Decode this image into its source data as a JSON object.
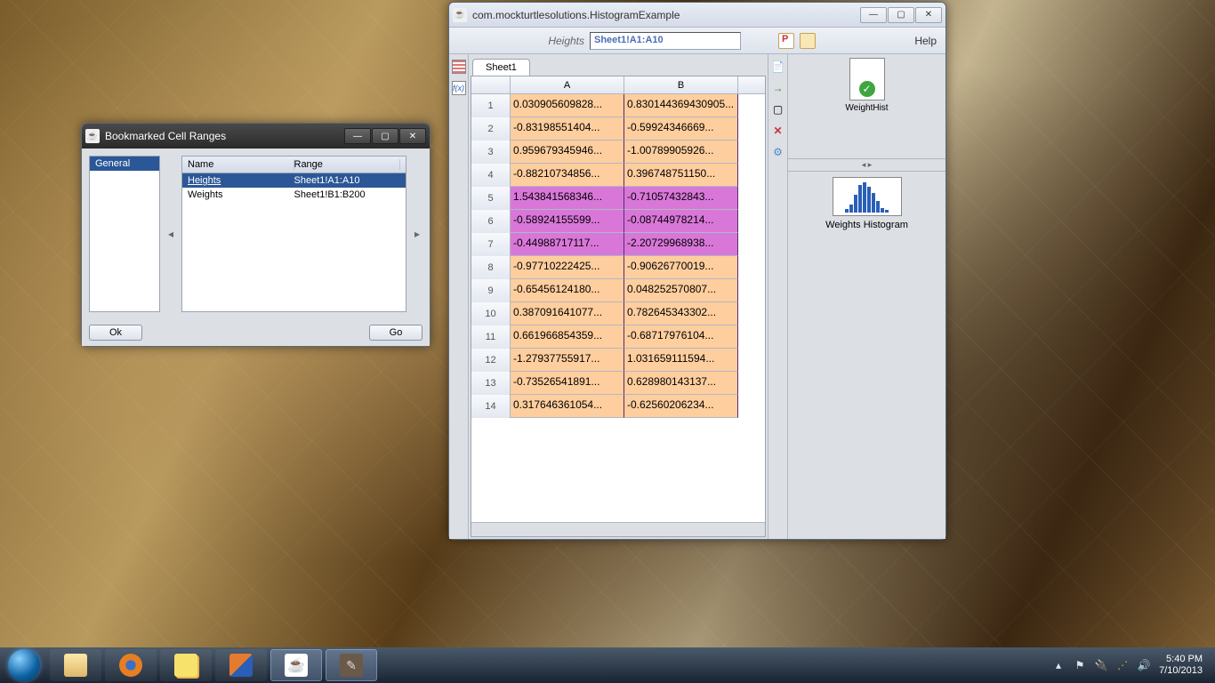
{
  "bookmarks_window": {
    "title": "Bookmarked Cell Ranges",
    "category": "General",
    "columns": {
      "name": "Name",
      "range": "Range"
    },
    "rows": [
      {
        "name": "Heights",
        "range": "Sheet1!A1:A10",
        "selected": true
      },
      {
        "name": "Weights",
        "range": "Sheet1!B1:B200",
        "selected": false
      }
    ],
    "ok": "Ok",
    "go": "Go"
  },
  "main_window": {
    "title": "com.mockturtlesolutions.HistogramExample",
    "formula_label": "Heights",
    "formula_value": "Sheet1!A1:A10",
    "help": "Help",
    "active_tab": "Sheet1",
    "fx_label": "f(x)",
    "columns": [
      "A",
      "B"
    ],
    "cell_rows": [
      {
        "n": "1",
        "a": "0.030905609828...",
        "b": "0.830144369430905...",
        "ca": "orange",
        "cb": "orange"
      },
      {
        "n": "2",
        "a": "-0.83198551404...",
        "b": "-0.59924346669...",
        "ca": "orange",
        "cb": "orange"
      },
      {
        "n": "3",
        "a": "0.959679345946...",
        "b": "-1.00789905926...",
        "ca": "orange",
        "cb": "orange"
      },
      {
        "n": "4",
        "a": "-0.88210734856...",
        "b": "0.396748751150...",
        "ca": "orange",
        "cb": "orange"
      },
      {
        "n": "5",
        "a": "1.543841568346...",
        "b": "-0.71057432843...",
        "ca": "mag",
        "cb": "mag"
      },
      {
        "n": "6",
        "a": "-0.58924155599...",
        "b": "-0.08744978214...",
        "ca": "mag",
        "cb": "mag"
      },
      {
        "n": "7",
        "a": "-0.44988717117...",
        "b": "-2.20729968938...",
        "ca": "mag",
        "cb": "mag"
      },
      {
        "n": "8",
        "a": "-0.97710222425...",
        "b": "-0.90626770019...",
        "ca": "orange",
        "cb": "orange"
      },
      {
        "n": "9",
        "a": "-0.65456124180...",
        "b": "0.048252570807...",
        "ca": "orange",
        "cb": "orange"
      },
      {
        "n": "10",
        "a": "0.387091641077...",
        "b": "0.782645343302...",
        "ca": "orange",
        "cb": "orange"
      },
      {
        "n": "11",
        "a": "0.661966854359...",
        "b": "-0.68717976104...",
        "ca": "orange",
        "cb": "orange"
      },
      {
        "n": "12",
        "a": "-1.27937755917...",
        "b": "1.031659111594...",
        "ca": "orange",
        "cb": "orange"
      },
      {
        "n": "13",
        "a": "-0.73526541891...",
        "b": "0.628980143137...",
        "ca": "orange",
        "cb": "orange"
      },
      {
        "n": "14",
        "a": "0.317646361054...",
        "b": "-0.62560206234...",
        "ca": "orange",
        "cb": "orange"
      }
    ],
    "side": {
      "file_name": "WeightHist",
      "hist_label": "Weights Histogram"
    }
  },
  "taskbar": {
    "time": "5:40 PM",
    "date": "7/10/2013"
  }
}
